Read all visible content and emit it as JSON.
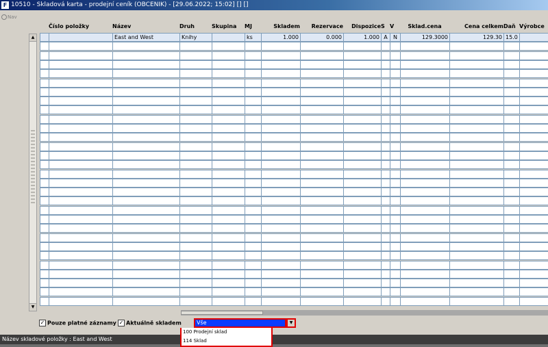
{
  "window": {
    "title": "10510 - Skladová karta - prodejní ceník (OBCENIK) - [29.06.2022; 15:02] [] []"
  },
  "nav": {
    "label": "Nav"
  },
  "table": {
    "columns": [
      "",
      "Číslo položky",
      "Název",
      "Druh",
      "Skupina",
      "MJ",
      "Skladem",
      "Rezervace",
      "Dispozice",
      "S",
      "V",
      "Sklad.cena",
      "Cena celkem",
      "Daň",
      "Výrobce"
    ],
    "rows": [
      [
        "",
        "",
        "East and West",
        "Knihy",
        "",
        "ks",
        "1.000",
        "0.000",
        "1.000",
        "A",
        "N",
        "129.3000",
        "129.30",
        "15.0",
        ""
      ]
    ]
  },
  "filters": {
    "only_valid_label": "Pouze platné záznamy",
    "only_valid_checked": "✓",
    "in_stock_label": "Aktuálně skladem",
    "in_stock_checked": "✓",
    "warehouse_selected": "Vše"
  },
  "dropdown": {
    "options": [
      "Vše",
      "100 Prodejní sklad",
      "114 Sklad"
    ]
  },
  "status": {
    "text": "Název skladové položky : East and West"
  }
}
